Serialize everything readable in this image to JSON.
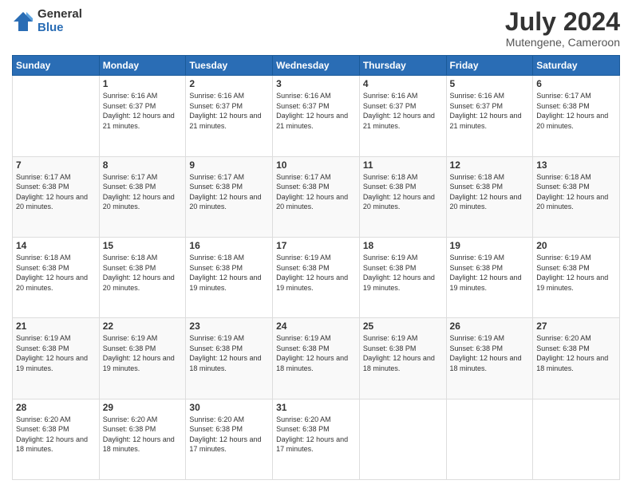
{
  "header": {
    "logo": {
      "general": "General",
      "blue": "Blue"
    },
    "title": "July 2024",
    "location": "Mutengene, Cameroon"
  },
  "days_of_week": [
    "Sunday",
    "Monday",
    "Tuesday",
    "Wednesday",
    "Thursday",
    "Friday",
    "Saturday"
  ],
  "weeks": [
    [
      {
        "day": "",
        "sunrise": "",
        "sunset": "",
        "daylight": ""
      },
      {
        "day": "1",
        "sunrise": "Sunrise: 6:16 AM",
        "sunset": "Sunset: 6:37 PM",
        "daylight": "Daylight: 12 hours and 21 minutes."
      },
      {
        "day": "2",
        "sunrise": "Sunrise: 6:16 AM",
        "sunset": "Sunset: 6:37 PM",
        "daylight": "Daylight: 12 hours and 21 minutes."
      },
      {
        "day": "3",
        "sunrise": "Sunrise: 6:16 AM",
        "sunset": "Sunset: 6:37 PM",
        "daylight": "Daylight: 12 hours and 21 minutes."
      },
      {
        "day": "4",
        "sunrise": "Sunrise: 6:16 AM",
        "sunset": "Sunset: 6:37 PM",
        "daylight": "Daylight: 12 hours and 21 minutes."
      },
      {
        "day": "5",
        "sunrise": "Sunrise: 6:16 AM",
        "sunset": "Sunset: 6:37 PM",
        "daylight": "Daylight: 12 hours and 21 minutes."
      },
      {
        "day": "6",
        "sunrise": "Sunrise: 6:17 AM",
        "sunset": "Sunset: 6:38 PM",
        "daylight": "Daylight: 12 hours and 20 minutes."
      }
    ],
    [
      {
        "day": "7",
        "sunrise": "Sunrise: 6:17 AM",
        "sunset": "Sunset: 6:38 PM",
        "daylight": "Daylight: 12 hours and 20 minutes."
      },
      {
        "day": "8",
        "sunrise": "Sunrise: 6:17 AM",
        "sunset": "Sunset: 6:38 PM",
        "daylight": "Daylight: 12 hours and 20 minutes."
      },
      {
        "day": "9",
        "sunrise": "Sunrise: 6:17 AM",
        "sunset": "Sunset: 6:38 PM",
        "daylight": "Daylight: 12 hours and 20 minutes."
      },
      {
        "day": "10",
        "sunrise": "Sunrise: 6:17 AM",
        "sunset": "Sunset: 6:38 PM",
        "daylight": "Daylight: 12 hours and 20 minutes."
      },
      {
        "day": "11",
        "sunrise": "Sunrise: 6:18 AM",
        "sunset": "Sunset: 6:38 PM",
        "daylight": "Daylight: 12 hours and 20 minutes."
      },
      {
        "day": "12",
        "sunrise": "Sunrise: 6:18 AM",
        "sunset": "Sunset: 6:38 PM",
        "daylight": "Daylight: 12 hours and 20 minutes."
      },
      {
        "day": "13",
        "sunrise": "Sunrise: 6:18 AM",
        "sunset": "Sunset: 6:38 PM",
        "daylight": "Daylight: 12 hours and 20 minutes."
      }
    ],
    [
      {
        "day": "14",
        "sunrise": "Sunrise: 6:18 AM",
        "sunset": "Sunset: 6:38 PM",
        "daylight": "Daylight: 12 hours and 20 minutes."
      },
      {
        "day": "15",
        "sunrise": "Sunrise: 6:18 AM",
        "sunset": "Sunset: 6:38 PM",
        "daylight": "Daylight: 12 hours and 20 minutes."
      },
      {
        "day": "16",
        "sunrise": "Sunrise: 6:18 AM",
        "sunset": "Sunset: 6:38 PM",
        "daylight": "Daylight: 12 hours and 19 minutes."
      },
      {
        "day": "17",
        "sunrise": "Sunrise: 6:19 AM",
        "sunset": "Sunset: 6:38 PM",
        "daylight": "Daylight: 12 hours and 19 minutes."
      },
      {
        "day": "18",
        "sunrise": "Sunrise: 6:19 AM",
        "sunset": "Sunset: 6:38 PM",
        "daylight": "Daylight: 12 hours and 19 minutes."
      },
      {
        "day": "19",
        "sunrise": "Sunrise: 6:19 AM",
        "sunset": "Sunset: 6:38 PM",
        "daylight": "Daylight: 12 hours and 19 minutes."
      },
      {
        "day": "20",
        "sunrise": "Sunrise: 6:19 AM",
        "sunset": "Sunset: 6:38 PM",
        "daylight": "Daylight: 12 hours and 19 minutes."
      }
    ],
    [
      {
        "day": "21",
        "sunrise": "Sunrise: 6:19 AM",
        "sunset": "Sunset: 6:38 PM",
        "daylight": "Daylight: 12 hours and 19 minutes."
      },
      {
        "day": "22",
        "sunrise": "Sunrise: 6:19 AM",
        "sunset": "Sunset: 6:38 PM",
        "daylight": "Daylight: 12 hours and 19 minutes."
      },
      {
        "day": "23",
        "sunrise": "Sunrise: 6:19 AM",
        "sunset": "Sunset: 6:38 PM",
        "daylight": "Daylight: 12 hours and 18 minutes."
      },
      {
        "day": "24",
        "sunrise": "Sunrise: 6:19 AM",
        "sunset": "Sunset: 6:38 PM",
        "daylight": "Daylight: 12 hours and 18 minutes."
      },
      {
        "day": "25",
        "sunrise": "Sunrise: 6:19 AM",
        "sunset": "Sunset: 6:38 PM",
        "daylight": "Daylight: 12 hours and 18 minutes."
      },
      {
        "day": "26",
        "sunrise": "Sunrise: 6:19 AM",
        "sunset": "Sunset: 6:38 PM",
        "daylight": "Daylight: 12 hours and 18 minutes."
      },
      {
        "day": "27",
        "sunrise": "Sunrise: 6:20 AM",
        "sunset": "Sunset: 6:38 PM",
        "daylight": "Daylight: 12 hours and 18 minutes."
      }
    ],
    [
      {
        "day": "28",
        "sunrise": "Sunrise: 6:20 AM",
        "sunset": "Sunset: 6:38 PM",
        "daylight": "Daylight: 12 hours and 18 minutes."
      },
      {
        "day": "29",
        "sunrise": "Sunrise: 6:20 AM",
        "sunset": "Sunset: 6:38 PM",
        "daylight": "Daylight: 12 hours and 18 minutes."
      },
      {
        "day": "30",
        "sunrise": "Sunrise: 6:20 AM",
        "sunset": "Sunset: 6:38 PM",
        "daylight": "Daylight: 12 hours and 17 minutes."
      },
      {
        "day": "31",
        "sunrise": "Sunrise: 6:20 AM",
        "sunset": "Sunset: 6:38 PM",
        "daylight": "Daylight: 12 hours and 17 minutes."
      },
      {
        "day": "",
        "sunrise": "",
        "sunset": "",
        "daylight": ""
      },
      {
        "day": "",
        "sunrise": "",
        "sunset": "",
        "daylight": ""
      },
      {
        "day": "",
        "sunrise": "",
        "sunset": "",
        "daylight": ""
      }
    ]
  ]
}
